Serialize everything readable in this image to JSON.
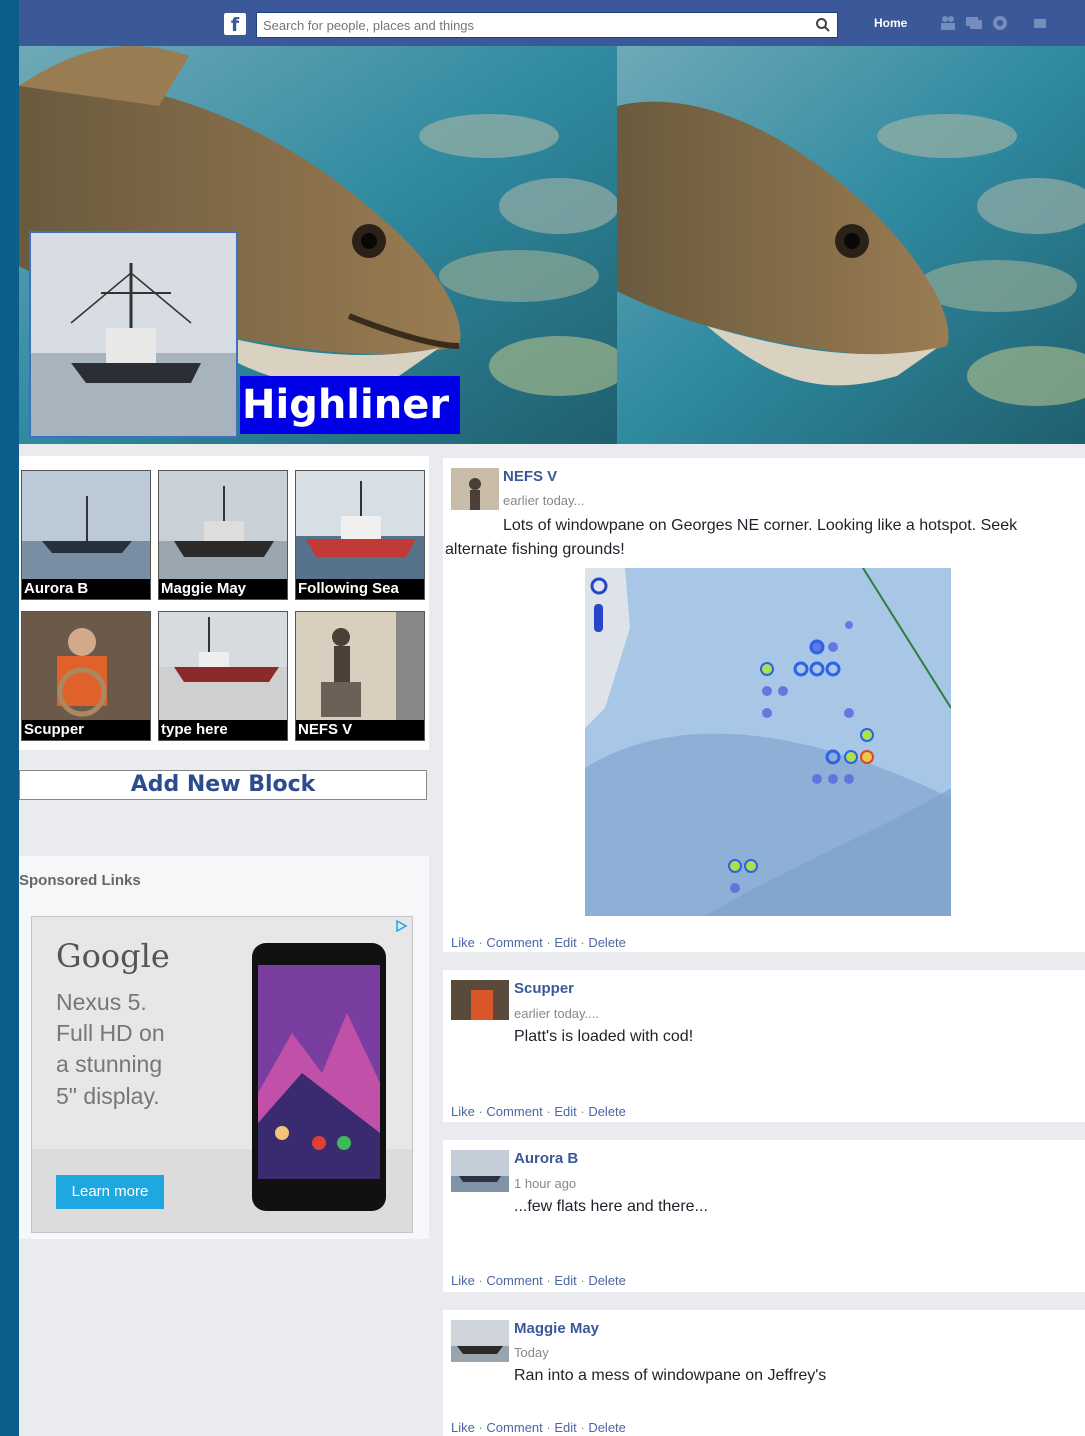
{
  "topbar": {
    "logo": "f",
    "search_placeholder": "Search for people, places and things",
    "home_label": "Home",
    "icons": [
      "friends-icon",
      "messages-icon",
      "globe-icon",
      "settings-icon"
    ]
  },
  "cover": {
    "title": "Highliner"
  },
  "vessels": [
    {
      "label": "Aurora B"
    },
    {
      "label": "Maggie May"
    },
    {
      "label": "Following Sea"
    },
    {
      "label": "Scupper"
    },
    {
      "label": "type here"
    },
    {
      "label": "NEFS V"
    }
  ],
  "add_block_label": "Add New Block",
  "sponsored": {
    "title": "Sponsored Links",
    "ad": {
      "brand": "Google",
      "lines": [
        "Nexus 5.",
        "Full HD on",
        "a stunning",
        "5\" display."
      ],
      "button": "Learn more"
    }
  },
  "posts": [
    {
      "author": "NEFS V",
      "time": "earlier today...",
      "text": "Lots of windowpane on Georges NE corner. Looking like a hotspot. Seek alternate fishing grounds!",
      "has_map": true
    },
    {
      "author": "Scupper",
      "time": "earlier today....",
      "text": "Platt's is loaded with cod!"
    },
    {
      "author": "Aurora B",
      "time": "1 hour ago",
      "text": "...few flats here and there..."
    },
    {
      "author": "Maggie May",
      "time": "Today",
      "text": "Ran into a mess of windowpane on Jeffrey's"
    }
  ],
  "actions": {
    "like": "Like",
    "comment": "Comment",
    "edit": "Edit",
    "delete": "Delete",
    "sep": " · "
  },
  "colors": {
    "brand": "#3b5998",
    "banner": "#0000e6",
    "link": "#4b67a1",
    "ad_button": "#1fa8e0"
  }
}
